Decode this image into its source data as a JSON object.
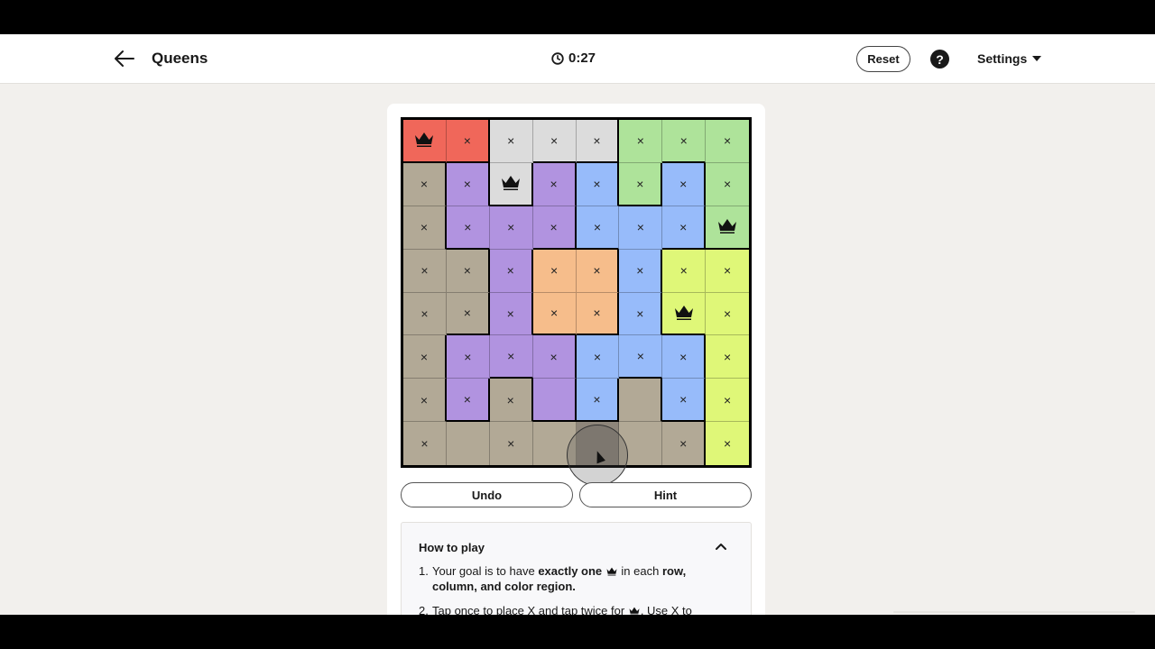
{
  "header": {
    "back_icon": "arrow-left-icon",
    "title": "Queens",
    "timer": "0:27",
    "timer_icon": "clock-icon",
    "reset_label": "Reset",
    "help_label": "?",
    "settings_label": "Settings"
  },
  "colors": {
    "R": "#f0675a",
    "W": "#dcdcdc",
    "G": "#aee39a",
    "T": "#b2a996",
    "P": "#b193e0",
    "B": "#97bbfa",
    "O": "#f6bd8b",
    "Y": "#dff778"
  },
  "board": {
    "size": 8,
    "regions": [
      "RRWWWGGG",
      "TPWPBGBG",
      "TPPPBBBG",
      "TTPOOBYY",
      "TTPOOBYY",
      "TPPPBBBY",
      "TPTPBTBY",
      "TTTTTTTY"
    ],
    "marks": [
      "QXXXXXXX",
      "XXQXXXXX",
      "XXXXXXXQ",
      "XXXXXXXX",
      "XXXXXXQX",
      "XXXXXXXX",
      "XXX.X.XX",
      "X.X...XX"
    ],
    "mark_x": "×",
    "queen_icon": "crown-icon",
    "highlighted_cell": [
      7,
      4
    ],
    "highlight_color": "#8d857a"
  },
  "buttons": {
    "undo": "Undo",
    "hint": "Hint"
  },
  "howto": {
    "title": "How to play",
    "rule1_num": "1.",
    "rule1_a": "Your goal is to have ",
    "rule1_b": "exactly one",
    "rule1_c": " in each ",
    "rule1_d": "row, column, and color region.",
    "rule2_num": "2.",
    "rule2_a": "Tap once to place X and tap twice for",
    "rule2_b": ". Use X to"
  }
}
